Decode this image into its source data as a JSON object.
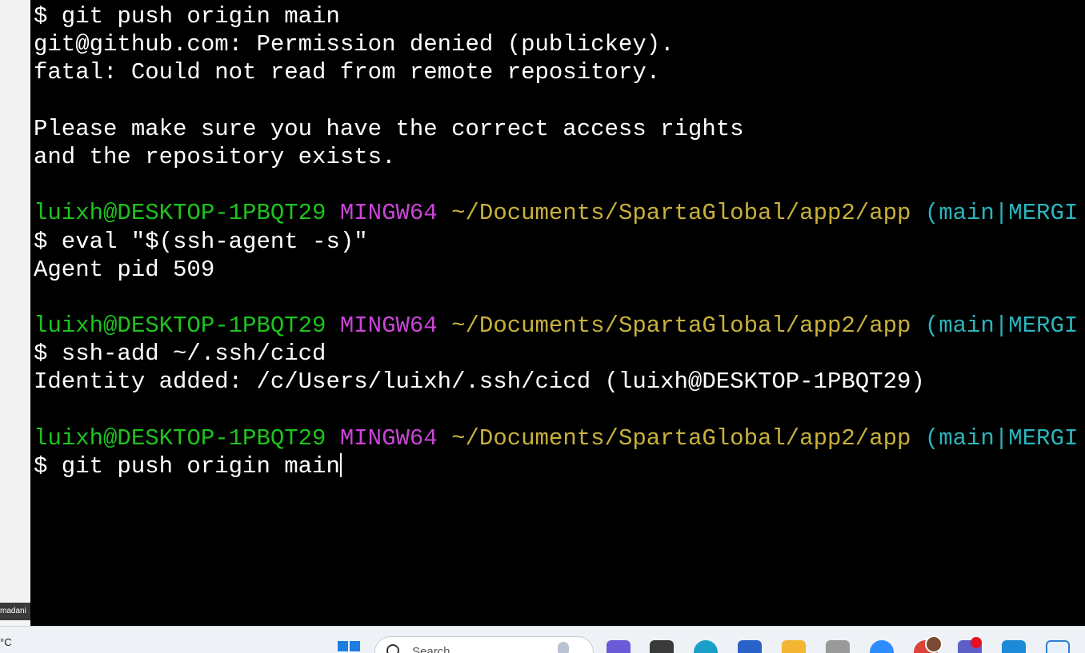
{
  "user_chip": "madani",
  "terminal": {
    "lines": [
      {
        "kind": "cmd",
        "text": "$ git push origin main"
      },
      {
        "kind": "out",
        "text": "git@github.com: Permission denied (publickey)."
      },
      {
        "kind": "out",
        "text": "fatal: Could not read from remote repository."
      },
      {
        "kind": "blank",
        "text": ""
      },
      {
        "kind": "out",
        "text": "Please make sure you have the correct access rights"
      },
      {
        "kind": "out",
        "text": "and the repository exists."
      },
      {
        "kind": "blank",
        "text": ""
      },
      {
        "kind": "prompt",
        "user": "luixh@DESKTOP-1PBQT29",
        "sys": "MINGW64",
        "path": "~/Documents/SpartaGlobal/app2/app",
        "branch": "(main|MERGI"
      },
      {
        "kind": "cmd",
        "text": "$ eval \"$(ssh-agent -s)\""
      },
      {
        "kind": "out",
        "text": "Agent pid 509"
      },
      {
        "kind": "blank",
        "text": ""
      },
      {
        "kind": "prompt",
        "user": "luixh@DESKTOP-1PBQT29",
        "sys": "MINGW64",
        "path": "~/Documents/SpartaGlobal/app2/app",
        "branch": "(main|MERGI"
      },
      {
        "kind": "cmd",
        "text": "$ ssh-add ~/.ssh/cicd"
      },
      {
        "kind": "out",
        "text": "Identity added: /c/Users/luixh/.ssh/cicd (luixh@DESKTOP-1PBQT29)"
      },
      {
        "kind": "blank",
        "text": ""
      },
      {
        "kind": "prompt",
        "user": "luixh@DESKTOP-1PBQT29",
        "sys": "MINGW64",
        "path": "~/Documents/SpartaGlobal/app2/app",
        "branch": "(main|MERGI"
      },
      {
        "kind": "cmd",
        "text": "$ git push origin main",
        "cursor": true
      }
    ],
    "colors": {
      "background": "#000000",
      "text": "#ffffff",
      "user": "#1ec31e",
      "system": "#c945d6",
      "path": "#c9b13b",
      "branch": "#29b5bd"
    }
  },
  "taskbar": {
    "weather": "°C",
    "search_placeholder": "Search",
    "icons": [
      {
        "name": "start-icon"
      },
      {
        "name": "copilot-icon",
        "color": "#6b5bd6"
      },
      {
        "name": "task-view-icon",
        "color": "#3a3a3a"
      },
      {
        "name": "edge-icon",
        "color": "#1aa0c8"
      },
      {
        "name": "store-icon",
        "color": "#2a62c9"
      },
      {
        "name": "file-explorer-icon",
        "color": "#f2b632"
      },
      {
        "name": "notepad-icon",
        "color": "#9a9a9a"
      },
      {
        "name": "zoom-icon",
        "color": "#2d8cff"
      },
      {
        "name": "chrome-icon",
        "color": "#db4437"
      },
      {
        "name": "teams-icon",
        "color": "#5b5fc7"
      },
      {
        "name": "vscode-icon",
        "color": "#1c8ad8"
      },
      {
        "name": "notes-icon",
        "color": "#2f7fd6"
      }
    ]
  }
}
